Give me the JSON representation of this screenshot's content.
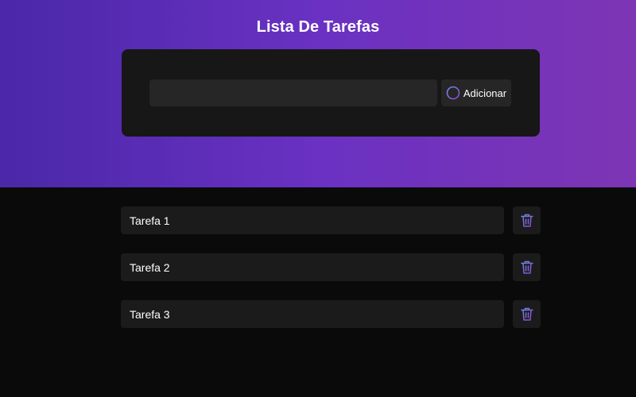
{
  "header": {
    "title": "Lista De Tarefas"
  },
  "form": {
    "input_value": "",
    "add_label": "Adicionar",
    "add_icon": "plus-circle-icon"
  },
  "tasks": [
    {
      "label": "Tarefa 1",
      "delete_icon": "trash-icon"
    },
    {
      "label": "Tarefa 2",
      "delete_icon": "trash-icon"
    },
    {
      "label": "Tarefa 3",
      "delete_icon": "trash-icon"
    }
  ],
  "colors": {
    "gradient_start": "#4a28a8",
    "gradient_mid": "#6a31c2",
    "gradient_end": "#7d35b4",
    "background": "#0a0a0a",
    "card": "#171717",
    "input": "#262626",
    "task_card": "#1b1b1b",
    "icon_gradient_start": "#6d8fe8",
    "icon_gradient_end": "#8a45cf"
  }
}
